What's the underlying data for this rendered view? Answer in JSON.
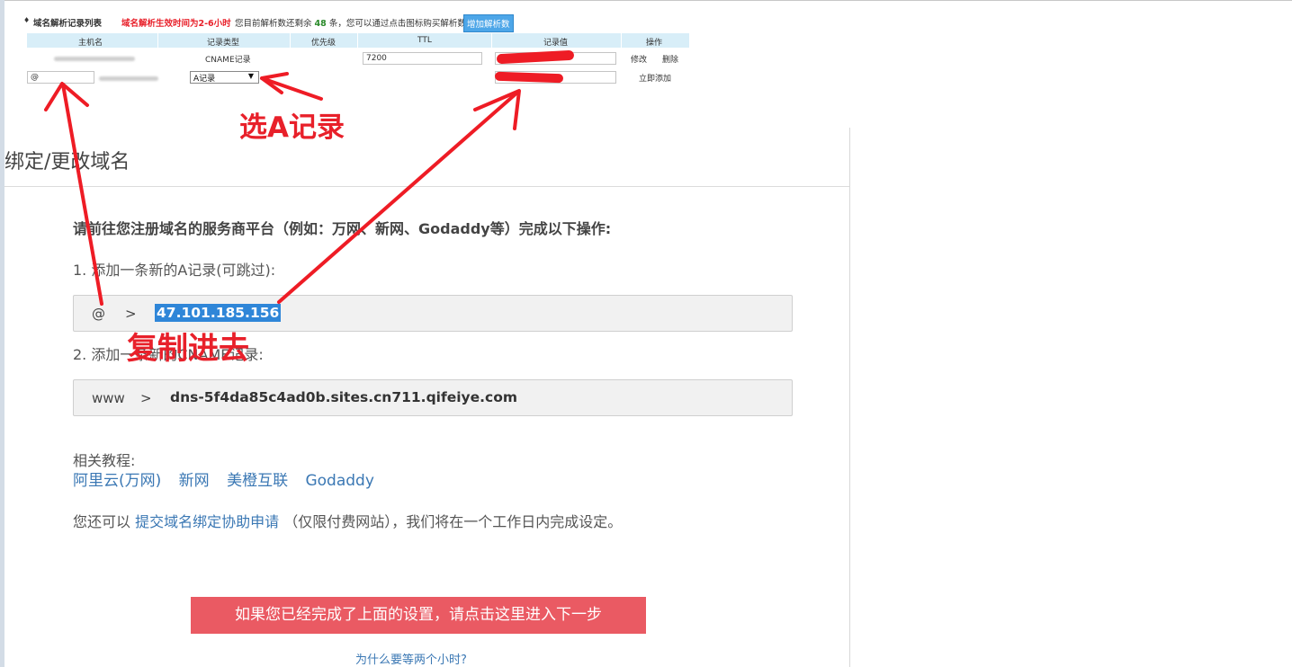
{
  "dns_table": {
    "bullet": "♦",
    "title": "域名解析记录列表",
    "warning": "域名解析生效时间为2-6小时",
    "info_prefix": "您目前解析数还剩余",
    "remaining": "48",
    "info_suffix": "条，您可以通过点击图标购买解析数",
    "add_button": "增加解析数",
    "headers": [
      "主机名",
      "记录类型",
      "优先级",
      "TTL",
      "记录值",
      "操作"
    ],
    "row1": {
      "type": "CNAME记录",
      "ttl": "7200",
      "edit": "修改",
      "delete": "删除"
    },
    "row2": {
      "host": "@",
      "type": "A记录",
      "add": "立即添加"
    }
  },
  "panel": {
    "title": "绑定/更改域名",
    "instruction": "请前往您注册域名的服务商平台（例如：万网、新网、Godaddy等）完成以下操作:",
    "step1": "1. 添加一条新的A记录(可跳过):",
    "record1": {
      "host": "@",
      "sep": ">",
      "value": "47.101.185.156"
    },
    "step2": "2. 添加一条新的CNAME记录:",
    "record2": {
      "host": "www",
      "sep": ">",
      "value": "dns-5f4da85c4ad0b.sites.cn711.qifeiye.com"
    },
    "tutorial_label": "相关教程:",
    "tutorials": [
      "阿里云(万网)",
      "新网",
      "美橙互联",
      "Godaddy"
    ],
    "submit_prefix": "您还可以",
    "submit_link": "提交域名绑定协助申请",
    "submit_suffix": "（仅限付费网站），我们将在一个工作日内完成设定。",
    "next_button": "如果您已经完成了上面的设置，请点击这里进入下一步",
    "why_link": "为什么要等两个小时?"
  },
  "annotations": {
    "select_a": "选A记录",
    "copy_in": "复制进去",
    "color": "#e8202a"
  }
}
